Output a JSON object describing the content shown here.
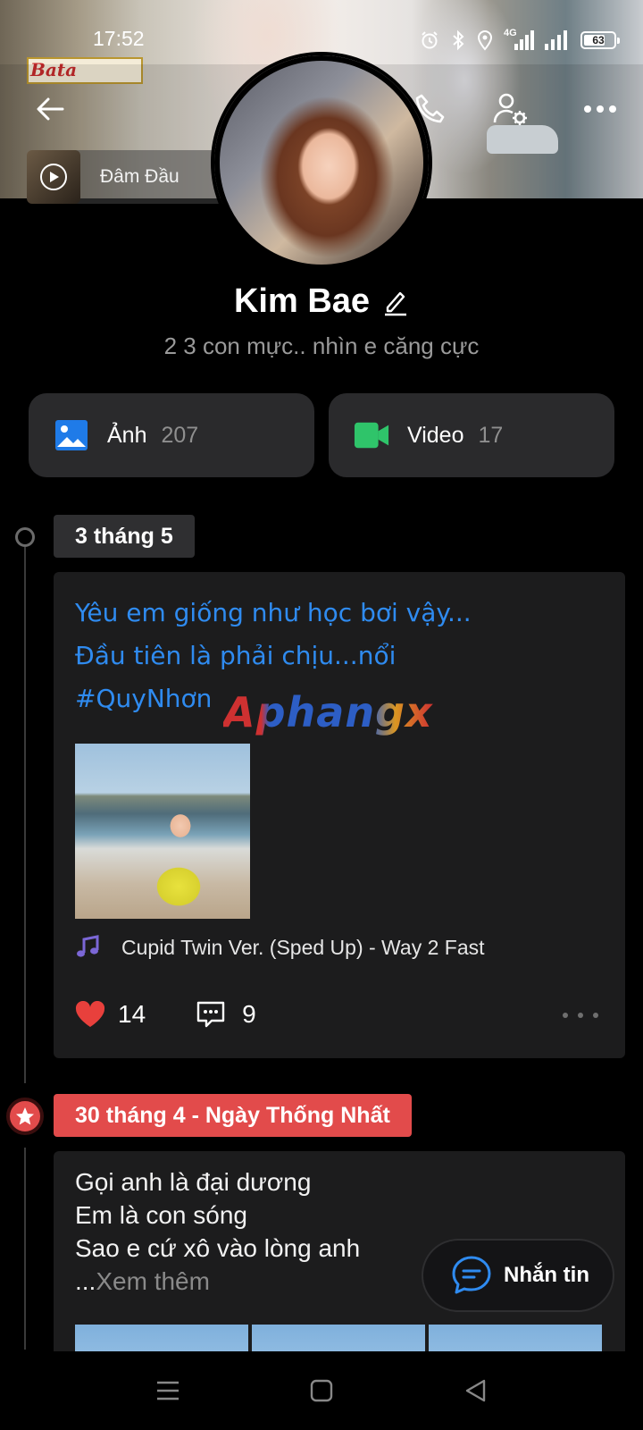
{
  "status_bar": {
    "time": "17:52",
    "network": "4G",
    "battery": "63"
  },
  "cover": {
    "sign_text": "Bata"
  },
  "music_chip": {
    "title": "Đâm Đầu"
  },
  "profile": {
    "name": "Kim Bae",
    "bio": "2 3 con mực.. nhìn e căng cực"
  },
  "media": {
    "photo_label": "Ảnh",
    "photo_count": "207",
    "video_label": "Video",
    "video_count": "17"
  },
  "timeline": [
    {
      "date": "3 tháng 5",
      "lines": [
        "Yêu em giống như học bơi vậy...",
        "Đầu tiên là phải chịu...nổi",
        "#QuyNhơn"
      ],
      "watermark": "Aphangx",
      "song": "Cupid Twin Ver. (Sped Up) - Way 2 Fast",
      "likes": "14",
      "comments": "9"
    },
    {
      "date": "30 tháng 4 - Ngày Thống Nhất",
      "lines": [
        "Gọi anh là đại dương",
        "Em là con sóng",
        "Sao e cứ xô vào lòng anh"
      ],
      "ellipsis": "...",
      "see_more": "Xem thêm"
    }
  ],
  "message_button": {
    "label": "Nhắn tin"
  },
  "colors": {
    "accent_blue": "#2f8bf0",
    "red_tag": "#e24b4b",
    "video_green": "#2fc46a",
    "heart_red": "#e8403c"
  },
  "icons": {
    "back": "arrow-left-icon",
    "call": "phone-icon",
    "profile_settings": "user-gear-icon",
    "more": "more-horizontal-icon",
    "photo": "image-icon",
    "video": "video-camera-icon",
    "music": "music-note-icon",
    "like": "heart-icon",
    "comment": "comment-icon",
    "star": "star-icon",
    "chat": "chat-bubble-icon"
  }
}
